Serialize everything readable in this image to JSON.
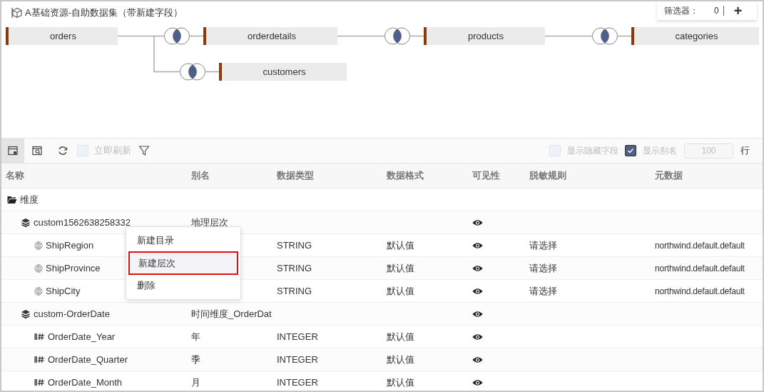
{
  "title": "A基础资源-自助数据集（带新建字段）",
  "filter_panel": {
    "label": "筛选器：",
    "count": "0",
    "add": "+"
  },
  "diagram": {
    "root": {
      "name": "orders",
      "children": [
        {
          "kind": "inner",
          "name": "orderdetails",
          "children": [
            {
              "kind": "inner",
              "name": "products",
              "children": [
                {
                  "kind": "inner",
                  "name": "categories"
                }
              ]
            }
          ]
        },
        {
          "kind": "inner",
          "name": "customers"
        }
      ]
    }
  },
  "toolbar": {
    "tools": [
      {
        "kind": "settings",
        "selected": true
      },
      {
        "kind": "preview",
        "selected": false
      },
      {
        "kind": "refresh",
        "selected": false
      }
    ],
    "auto_refresh": {
      "label": "立即刷新",
      "checked": false
    },
    "show_hidden": {
      "label": "显示隐藏字段",
      "checked": false
    },
    "show_alias": {
      "label": "显示别名",
      "checked": true
    },
    "row_limit": "100",
    "row_unit": "行"
  },
  "table": {
    "columns": [
      "名称",
      "别名",
      "数据类型",
      "数据格式",
      "可见性",
      "脱敏规则",
      "元数据"
    ],
    "rows": [
      {
        "kind": "folder",
        "name": "维度",
        "children": [
          {
            "kind": "hierarchy",
            "name": "custom1562638258332",
            "alias": "地理层次",
            "visible": true,
            "children": [
              {
                "kind": "geo",
                "name": "ShipRegion",
                "type": "STRING",
                "format": "默认值",
                "visible": true,
                "mask_rule": "请选择",
                "metadata": "northwind.default.default"
              },
              {
                "kind": "geo",
                "name": "ShipProvince",
                "type": "STRING",
                "format": "默认值",
                "visible": true,
                "mask_rule": "请选择",
                "metadata": "northwind.default.default"
              },
              {
                "kind": "geo",
                "name": "ShipCity",
                "type": "STRING",
                "format": "默认值",
                "visible": true,
                "mask_rule": "请选择",
                "metadata": "northwind.default.default"
              }
            ]
          },
          {
            "kind": "hierarchy",
            "name": "custom-OrderDate",
            "alias": "时间维度_OrderDat",
            "visible": true,
            "children": [
              {
                "kind": "number",
                "name": "OrderDate_Year",
                "alias": "年",
                "type": "INTEGER",
                "format": "默认值",
                "visible": true
              },
              {
                "kind": "number",
                "name": "OrderDate_Quarter",
                "alias": "季",
                "type": "INTEGER",
                "format": "默认值",
                "visible": true
              },
              {
                "kind": "number",
                "name": "OrderDate_Month",
                "alias": "月",
                "type": "INTEGER",
                "format": "默认值",
                "visible": true
              }
            ]
          }
        ]
      }
    ]
  },
  "context_menu": [
    {
      "label": "新建目录",
      "selected": false
    },
    {
      "label": "新建层次",
      "selected": true
    },
    {
      "label": "删除",
      "selected": false
    }
  ]
}
